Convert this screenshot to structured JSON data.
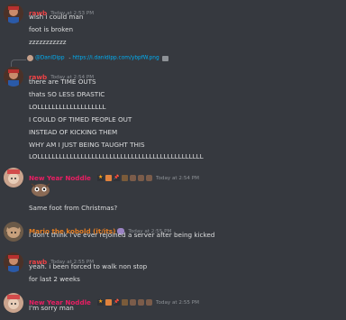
{
  "colors": {
    "background": "#36393f",
    "text": "#dcddde",
    "timestamp": "#8e9297",
    "rawb": "#ed4245",
    "nodder": "#e91e63",
    "mario": "#e67e22",
    "link": "#00aff4"
  },
  "messages": [
    {
      "author": "rawb",
      "timestamp": "Today at 2:53 PM",
      "lines": [
        "wish i could man",
        "foot is broken",
        "zzzzzzzzzzz"
      ]
    },
    {
      "reply": {
        "name": "@DaniDipp",
        "dash": " - ",
        "link": "https://i.danidipp.com/ybpfW.png"
      },
      "author": "rawb",
      "timestamp": "Today at 2:54 PM",
      "lines": [
        "there are TIME OUTS",
        "thats SO LESS DRASTIC",
        "LOLLLLLLLLLLLLLLLLLLL",
        "I COULD OF TIMED PEOPLE OUT",
        "INSTEAD OF KICKING THEM",
        "WHY AM I JUST BEING TAUGHT THIS",
        "LOLLLLLLLLLLLLLLLLLLLLLLLLLLLLLLLLLLLLLLLLLLLLLL"
      ]
    },
    {
      "author": "New Year Noddle",
      "timestamp": "Today at 2:54 PM",
      "lines": [
        "Same foot from Christmas?"
      ]
    },
    {
      "author": "Mario the kobold (it/its)",
      "timestamp": "Today at 2:55 PM",
      "lines": [
        "i don't think i've ever rejoined a server after being kicked"
      ]
    },
    {
      "author": "rawb",
      "timestamp": "Today at 2:55 PM",
      "lines": [
        "yeah. i been forced to walk non stop",
        "for last 2 weeks"
      ]
    },
    {
      "author": "New Year Noddle",
      "timestamp": "Today at 2:55 PM",
      "lines": [
        "I'm sorry man"
      ]
    }
  ]
}
